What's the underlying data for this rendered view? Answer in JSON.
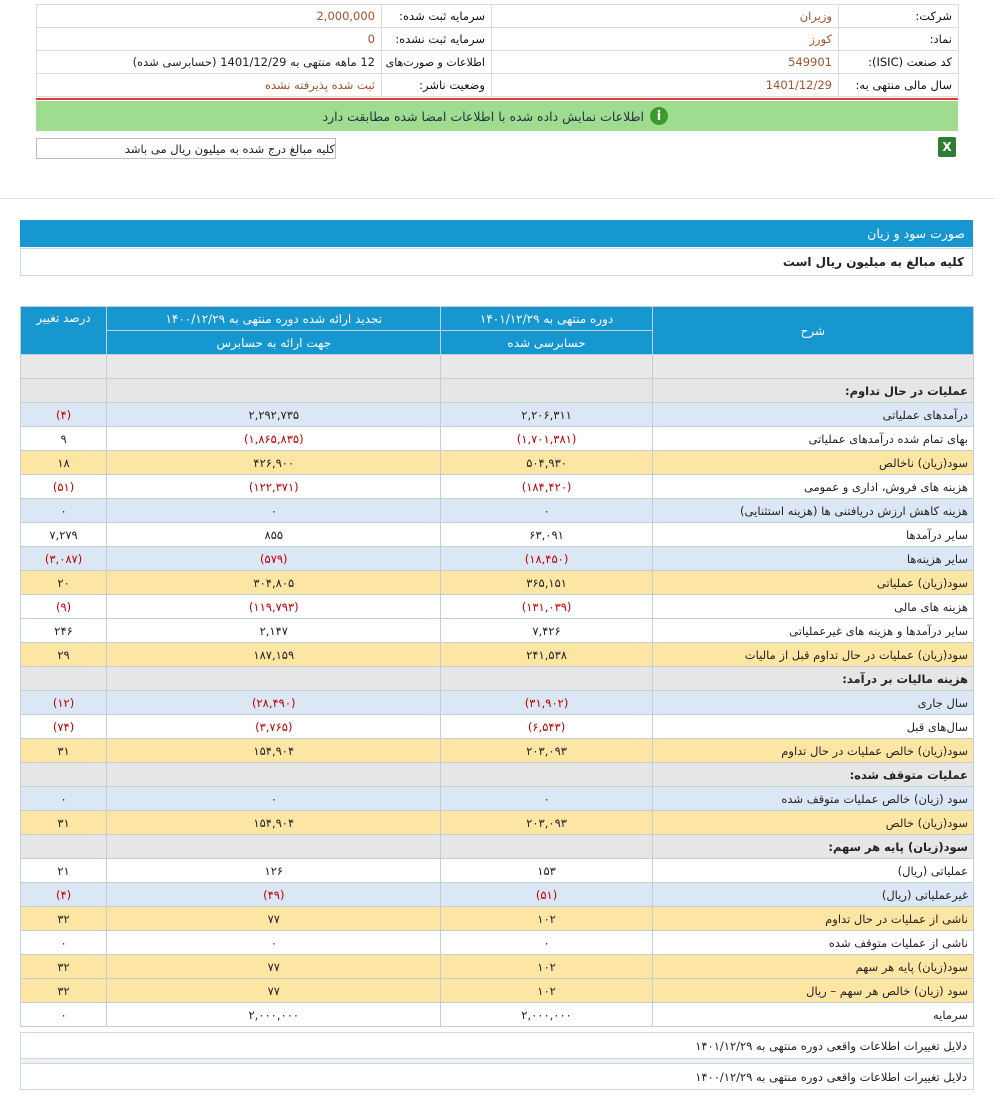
{
  "info": {
    "company_label": "شرکت:",
    "company_value": "وزیران",
    "reg_capital_label": "سرمایه ثبت شده:",
    "reg_capital_value": "2,000,000",
    "symbol_label": "نماد:",
    "symbol_value": "کورز",
    "unreg_capital_label": "سرمایه ثبت نشده:",
    "unreg_capital_value": "0",
    "isic_label": "کد صنعت (ISIC):",
    "isic_value": "549901",
    "period_info_label": "اطلاعات و صورت‌های مالی",
    "period_info_value": "12 ماهه منتهی به 1401/12/29",
    "period_info_suffix": "(حسابرسی شده)",
    "fiscal_year_label": "سال مالی منتهی به:",
    "fiscal_year_value": "1401/12/29",
    "publisher_status_label": "وضعیت ناشر:",
    "publisher_status_value": "ثبت شده پذیرفته نشده"
  },
  "notice": {
    "icon": "info-icon",
    "text": "اطلاعات نمایش داده شده با اطلاعات امضا شده مطابقت دارد"
  },
  "unit_note": "کلیه مبالغ درج شده به میلیون ریال می باشد",
  "excel_icon": "excel-icon",
  "section": {
    "title": "صورت سود و زیان",
    "subtitle": "کلیه مبالغ به میلیون ریال است"
  },
  "table": {
    "headers": {
      "desc": "شرح",
      "current_period": "دوره منتهی به ۱۴۰۱/۱۲/۲۹",
      "current_sub": "حسابرسی شده",
      "restated_period": "تجدید ارائه شده دوره منتهی به ۱۴۰۰/۱۲/۲۹",
      "restated_sub": "جهت ارائه به حسابرس",
      "change_pct": "درصد تغییر"
    },
    "rows": [
      {
        "kind": "gray",
        "desc": "",
        "cur": "",
        "prev": "",
        "pct": ""
      },
      {
        "kind": "head",
        "desc": "عملیات در حال تداوم:",
        "cur": "",
        "prev": "",
        "pct": ""
      },
      {
        "kind": "blue",
        "desc": "درآمدهای عملیاتی",
        "cur": "۲,۲۰۶,۳۱۱",
        "prev": "۲,۲۹۲,۷۳۵",
        "pct": "(۴)"
      },
      {
        "kind": "white",
        "desc": "بهاى تمام شده درآمدهای عملیاتی",
        "cur": "(۱,۷۰۱,۳۸۱)",
        "prev": "(۱,۸۶۵,۸۳۵)",
        "pct": "۹"
      },
      {
        "kind": "yellow",
        "desc": "سود(زیان) ناخالص",
        "cur": "۵۰۴,۹۳۰",
        "prev": "۴۲۶,۹۰۰",
        "pct": "۱۸"
      },
      {
        "kind": "white",
        "desc": "هزینه های فروش، اداری و عمومی",
        "cur": "(۱۸۴,۴۲۰)",
        "prev": "(۱۲۲,۳۷۱)",
        "pct": "(۵۱)"
      },
      {
        "kind": "blue",
        "desc": "هزینه کاهش ارزش دریافتنی ها (هزینه استثنایی)",
        "cur": "۰",
        "prev": "۰",
        "pct": "۰"
      },
      {
        "kind": "white",
        "desc": "سایر درآمدها",
        "cur": "۶۳,۰۹۱",
        "prev": "۸۵۵",
        "pct": "۷,۲۷۹"
      },
      {
        "kind": "blue",
        "desc": "سایر هزینه‌ها",
        "cur": "(۱۸,۴۵۰)",
        "prev": "(۵۷۹)",
        "pct": "(۳,۰۸۷)"
      },
      {
        "kind": "yellow",
        "desc": "سود(زیان) عملیاتی",
        "cur": "۳۶۵,۱۵۱",
        "prev": "۳۰۴,۸۰۵",
        "pct": "۲۰"
      },
      {
        "kind": "white",
        "desc": "هزینه های مالی",
        "cur": "(۱۳۱,۰۳۹)",
        "prev": "(۱۱۹,۷۹۳)",
        "pct": "(۹)"
      },
      {
        "kind": "white",
        "desc": "سایر درآمدها و هزینه های غیرعملیاتی",
        "cur": "۷,۴۲۶",
        "prev": "۲,۱۴۷",
        "pct": "۲۴۶"
      },
      {
        "kind": "yellow",
        "desc": "سود(زیان) عملیات در حال تداوم قبل از مالیات",
        "cur": "۲۴۱,۵۳۸",
        "prev": "۱۸۷,۱۵۹",
        "pct": "۲۹"
      },
      {
        "kind": "head",
        "desc": "هزینه مالیات بر درآمد:",
        "cur": "",
        "prev": "",
        "pct": ""
      },
      {
        "kind": "blue",
        "desc": "سال جاری",
        "cur": "(۳۱,۹۰۲)",
        "prev": "(۲۸,۴۹۰)",
        "pct": "(۱۲)"
      },
      {
        "kind": "white",
        "desc": "سال‌های قبل",
        "cur": "(۶,۵۴۳)",
        "prev": "(۳,۷۶۵)",
        "pct": "(۷۴)"
      },
      {
        "kind": "yellow",
        "desc": "سود(زیان) خالص عملیات در حال تداوم",
        "cur": "۲۰۳,۰۹۳",
        "prev": "۱۵۴,۹۰۴",
        "pct": "۳۱"
      },
      {
        "kind": "head",
        "desc": "عملیات متوقف شده:",
        "cur": "",
        "prev": "",
        "pct": ""
      },
      {
        "kind": "blue",
        "desc": "سود (زیان) خالص عملیات متوقف شده",
        "cur": "۰",
        "prev": "۰",
        "pct": "۰"
      },
      {
        "kind": "yellow",
        "desc": "سود(زیان) خالص",
        "cur": "۲۰۳,۰۹۳",
        "prev": "۱۵۴,۹۰۴",
        "pct": "۳۱"
      },
      {
        "kind": "head",
        "desc": "سود(زیان) پایه هر سهم:",
        "cur": "",
        "prev": "",
        "pct": ""
      },
      {
        "kind": "white",
        "desc": "عملیاتی (ریال)",
        "cur": "۱۵۳",
        "prev": "۱۲۶",
        "pct": "۲۱"
      },
      {
        "kind": "blue",
        "desc": "غیرعملیاتی (ریال)",
        "cur": "(۵۱)",
        "prev": "(۴۹)",
        "pct": "(۴)"
      },
      {
        "kind": "yellow",
        "desc": "ناشی از عملیات در حال تداوم",
        "cur": "۱۰۲",
        "prev": "۷۷",
        "pct": "۳۲"
      },
      {
        "kind": "white",
        "desc": "ناشی از عملیات متوقف شده",
        "cur": "۰",
        "prev": "۰",
        "pct": "۰"
      },
      {
        "kind": "yellow",
        "desc": "سود(زیان) پایه هر سهم",
        "cur": "۱۰۲",
        "prev": "۷۷",
        "pct": "۳۲"
      },
      {
        "kind": "yellow",
        "desc": "سود (زیان) خالص هر سهم – ریال",
        "cur": "۱۰۲",
        "prev": "۷۷",
        "pct": "۳۲"
      },
      {
        "kind": "white",
        "desc": "سرمایه",
        "cur": "۲,۰۰۰,۰۰۰",
        "prev": "۲,۰۰۰,۰۰۰",
        "pct": "۰"
      }
    ]
  },
  "notes": [
    "دلایل تغییرات اطلاعات واقعی دوره منتهی به ۱۴۰۱/۱۲/۲۹",
    "دلایل تغییرات اطلاعات واقعی دوره منتهی به ۱۴۰۰/۱۲/۲۹"
  ],
  "colors": {
    "header_blue": "#1797cf",
    "negative_red": "#c00000",
    "notice_green": "#9fdc90",
    "row_yellow": "#fde6a4",
    "row_blue": "#dbe7f4"
  }
}
